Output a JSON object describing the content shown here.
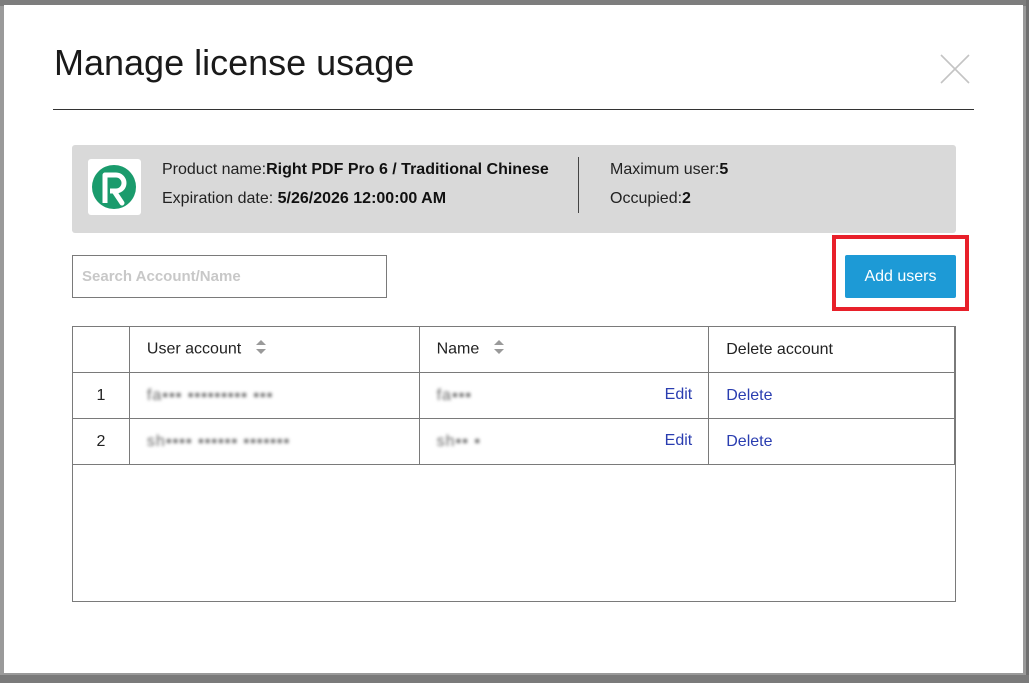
{
  "dialog": {
    "title": "Manage license usage"
  },
  "product": {
    "name_label": "Product name:",
    "name_value": "Right PDF Pro 6 / Traditional Chinese",
    "expiration_label": "Expiration date:",
    "expiration_value": "5/26/2026 12:00:00 AM",
    "max_user_label": "Maximum user:",
    "max_user_value": "5",
    "occupied_label": "Occupied:",
    "occupied_value": "2",
    "logo_icon": "right-pdf-logo-icon",
    "logo_color": "#1a9b6c"
  },
  "search": {
    "placeholder": "Search Account/Name",
    "value": ""
  },
  "actions": {
    "add_users_label": "Add users",
    "highlight_color": "#e8202a",
    "button_color": "#1d9ad6"
  },
  "table": {
    "columns": {
      "index": "",
      "account": "User account",
      "name": "Name",
      "delete": "Delete account"
    },
    "rows": [
      {
        "index": "1",
        "account": "fa▪▪▪ ▪▪▪▪▪▪▪▪▪ ▪▪▪",
        "name": "fa▪▪▪",
        "edit": "Edit",
        "delete": "Delete"
      },
      {
        "index": "2",
        "account": "sh▪▪▪▪ ▪▪▪▪▪▪ ▪▪▪▪▪▪▪",
        "name": "sh▪▪ ▪",
        "edit": "Edit",
        "delete": "Delete"
      }
    ]
  }
}
